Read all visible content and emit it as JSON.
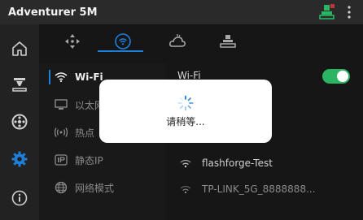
{
  "app": {
    "title": "Adventurer 5M"
  },
  "colors": {
    "accent": "#1e7fd8",
    "toggle_on": "#2bb463",
    "printer_icon": "#2bb463"
  },
  "status": {
    "printer_icon": "printer-status-icon"
  },
  "left_rail": [
    {
      "name": "home",
      "icon": "home-icon"
    },
    {
      "name": "print",
      "icon": "nozzle-icon"
    },
    {
      "name": "filament",
      "icon": "spool-icon"
    },
    {
      "name": "settings",
      "icon": "gear-icon",
      "active": true
    },
    {
      "name": "info",
      "icon": "info-icon"
    }
  ],
  "top_tabs": [
    {
      "name": "move",
      "icon": "move-arrows-icon"
    },
    {
      "name": "network",
      "icon": "wifi-circle-icon",
      "active": true
    },
    {
      "name": "cloud",
      "icon": "cloud-icon"
    },
    {
      "name": "printer",
      "icon": "printer-icon"
    }
  ],
  "network_menu": {
    "items": [
      {
        "label": "Wi-Fi",
        "icon": "wifi-icon",
        "active": true
      },
      {
        "label": "以太网",
        "icon": "ethernet-icon"
      },
      {
        "label": "热点",
        "icon": "hotspot-icon"
      },
      {
        "label": "静态IP",
        "icon": "ip-icon"
      },
      {
        "label": "网络模式",
        "icon": "globe-icon"
      }
    ]
  },
  "wifi_panel": {
    "label": "Wi-Fi",
    "enabled": true,
    "networks": [
      {
        "ssid": "flashforge-Test"
      },
      {
        "ssid": "TP-LINK_5G_8888888..."
      }
    ]
  },
  "modal": {
    "text": "请稍等..."
  }
}
